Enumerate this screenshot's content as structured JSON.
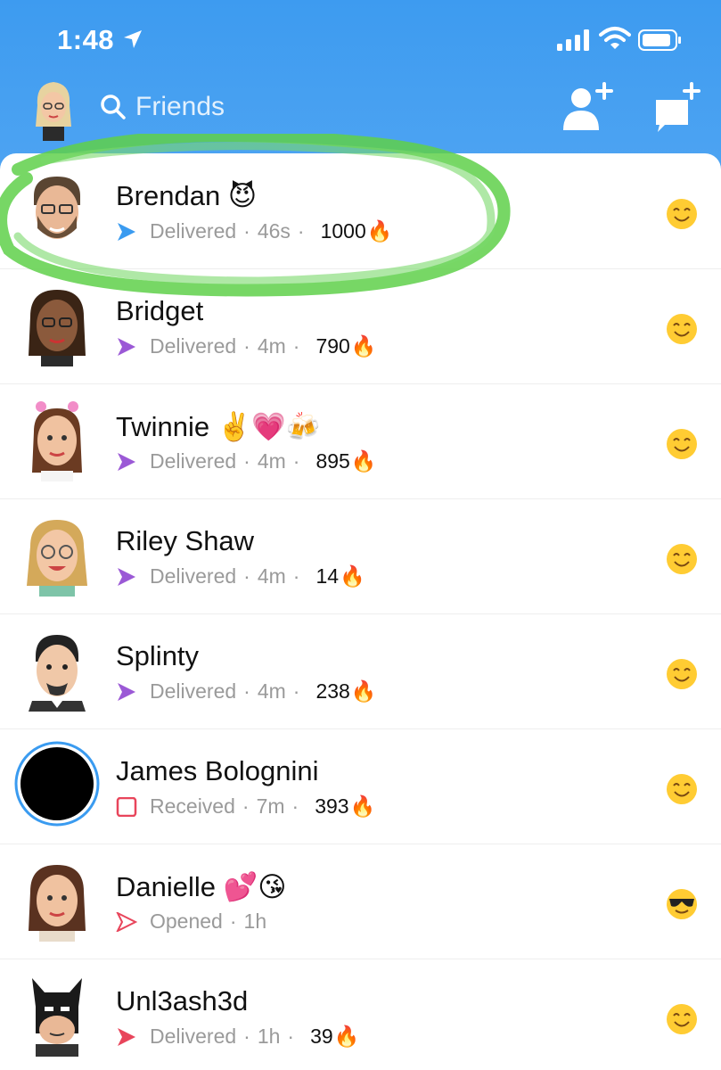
{
  "status_bar": {
    "time": "1:48"
  },
  "header": {
    "search_placeholder": "Friends"
  },
  "colors": {
    "header_blue": "#4aa3f2",
    "delivered_blue": "#3a9bf0",
    "delivered_purple": "#9b59d6",
    "received_red": "#e8455b",
    "highlight_green": "#5fd04a"
  },
  "chats": [
    {
      "name": "Brendan",
      "name_emoji": "😈",
      "status": "Delivered",
      "time": "46s",
      "streak": "1000",
      "fire": "🔥",
      "friend_emoji": "😊",
      "icon": "delivered-blue-arrow"
    },
    {
      "name": "Bridget",
      "name_emoji": "",
      "status": "Delivered",
      "time": "4m",
      "streak": "790",
      "fire": "🔥",
      "friend_emoji": "😊",
      "icon": "delivered-purple-arrow"
    },
    {
      "name": "Twinnie",
      "name_emoji": "✌️💗🍻",
      "status": "Delivered",
      "time": "4m",
      "streak": "895",
      "fire": "🔥",
      "friend_emoji": "😊",
      "icon": "delivered-purple-arrow"
    },
    {
      "name": "Riley Shaw",
      "name_emoji": "",
      "status": "Delivered",
      "time": "4m",
      "streak": "14",
      "fire": "🔥",
      "friend_emoji": "😊",
      "icon": "delivered-purple-arrow"
    },
    {
      "name": "Splinty",
      "name_emoji": "",
      "status": "Delivered",
      "time": "4m",
      "streak": "238",
      "fire": "🔥",
      "friend_emoji": "😊",
      "icon": "delivered-purple-arrow"
    },
    {
      "name": "James Bolognini",
      "name_emoji": "",
      "status": "Received",
      "time": "7m",
      "streak": "393",
      "fire": "🔥",
      "friend_emoji": "😊",
      "icon": "received-red-square"
    },
    {
      "name": "Danielle",
      "name_emoji": "💕😘",
      "status": "Opened",
      "time": "1h",
      "streak": "",
      "fire": "",
      "friend_emoji": "😎",
      "icon": "opened-red-arrow-outline"
    },
    {
      "name": "Unl3ash3d",
      "name_emoji": "",
      "status": "Delivered",
      "time": "1h",
      "streak": "39",
      "fire": "🔥",
      "friend_emoji": "😊",
      "icon": "delivered-red-arrow"
    }
  ]
}
